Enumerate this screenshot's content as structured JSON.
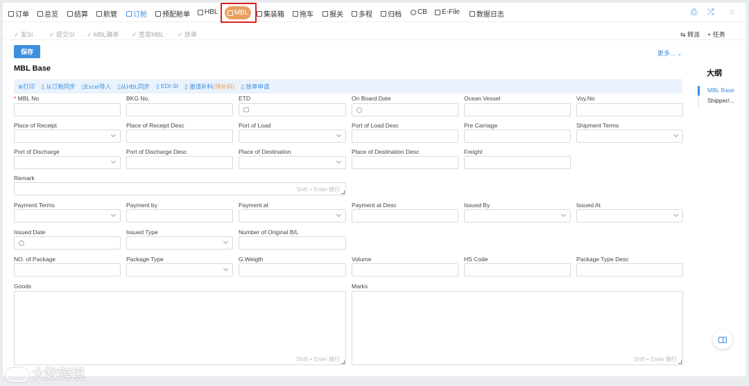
{
  "nav": {
    "tabs": [
      {
        "label": "订单"
      },
      {
        "label": "总览"
      },
      {
        "label": "结算"
      },
      {
        "label": "航管"
      },
      {
        "label": "订舱"
      },
      {
        "label": "预配舱单"
      },
      {
        "label": "HBL"
      },
      {
        "label": "MBL"
      },
      {
        "label": "集装箱"
      },
      {
        "label": "拖车"
      },
      {
        "label": "报关"
      },
      {
        "label": "多程"
      },
      {
        "label": "归档"
      },
      {
        "label": "CB"
      },
      {
        "label": "E-File"
      },
      {
        "label": "数据日志"
      }
    ],
    "right_icons": [
      "print-icon",
      "shuffle-icon",
      "star-icon"
    ]
  },
  "subnav": {
    "items": [
      "发SI",
      "提交SI",
      "MBL确单",
      "签发MBL",
      "放单"
    ],
    "transfer": "转派",
    "task": "任务"
  },
  "actions": {
    "save": "保存",
    "more": "更多..."
  },
  "section": {
    "title": "MBL Base"
  },
  "toolbar": {
    "print": "打印",
    "sync_booking": "从订舱同步",
    "excel_import": "Excel导入",
    "sync_hbl": "从HBL同步",
    "edi_si": "EDI-SI",
    "invite_supplement": "邀请补料",
    "invite_status": "(待补料)",
    "release_request": "放单申请"
  },
  "fields": {
    "mbl_no": "MBL No",
    "bkg_no": "BKG No.",
    "etd": "ETD",
    "on_board_date": "On Board Date",
    "ocean_vessel": "Ocean Vessel",
    "voy_no": "Voy.No",
    "place_of_receipt": "Place of Receipt",
    "place_of_receipt_desc": "Place of Receipt Desc",
    "port_of_load": "Port of Load",
    "port_of_load_desc": "Port of Load Desc",
    "pre_carriage": "Pre Carriage",
    "shipment_terms": "Shipment Terms",
    "port_of_discharge": "Port of Discharge",
    "port_of_discharge_desc": "Port of Discharge Desc",
    "place_of_destination": "Place of Destination",
    "place_of_destination_desc": "Place of Destination Desc",
    "freight": "Freight",
    "remark": "Remark",
    "payment_terms": "Payment Terms",
    "payment_by": "Payment by",
    "payment_at": "Payment at",
    "payment_at_desc": "Payment at Desc",
    "issued_by": "Issued By",
    "issued_at": "Issued At",
    "issued_date": "Issued Date",
    "issued_type": "Issued Type",
    "number_of_original_bl": "Number of Original B/L",
    "no_of_package": "NO. of Package",
    "package_type": "Package Type",
    "g_weigth": "G.Weigth",
    "volume": "Volume",
    "hs_code": "HS Code",
    "package_type_desc": "Package Type Desc",
    "goods": "Goods",
    "marks": "Marks",
    "textarea_hint": "Shift + Enter 换行"
  },
  "outline": {
    "title": "大纲",
    "items": [
      "MBL Base",
      "Shipper/..."
    ]
  },
  "watermark": "大数跨境",
  "colors": {
    "primary": "#3f8fe0",
    "mbl_tab": "#e8a060",
    "highlight": "#e02020"
  }
}
